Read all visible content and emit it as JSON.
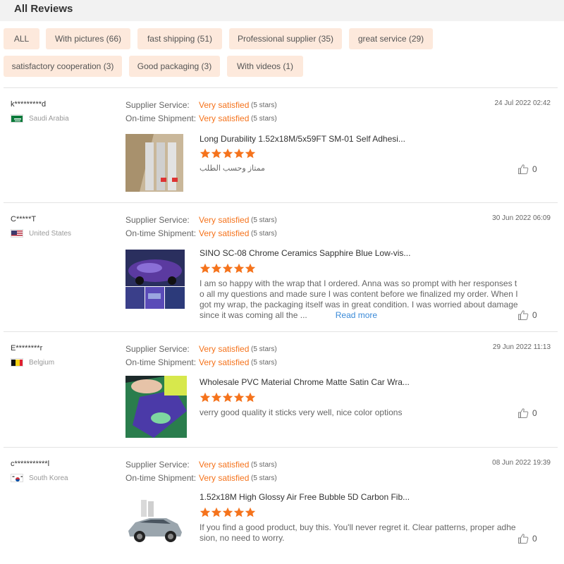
{
  "header": {
    "title": "All Reviews"
  },
  "filters": [
    {
      "label": "ALL"
    },
    {
      "label": "With pictures (66)"
    },
    {
      "label": "fast shipping (51)"
    },
    {
      "label": "Professional supplier (35)"
    },
    {
      "label": "great service (29)"
    },
    {
      "label": "satisfactory cooperation (3)"
    },
    {
      "label": "Good packaging (3)"
    },
    {
      "label": "With videos (1)"
    }
  ],
  "colors": {
    "accent": "#f5731c",
    "chip_bg": "#fde9dc",
    "link": "#3a8ad8"
  },
  "reviews": [
    {
      "user": "k*********d",
      "country": "Saudi Arabia",
      "flag": "saudi-arabia",
      "supplier_label": "Supplier Service:",
      "supplier_value": "Very satisfied",
      "supplier_stars": "(5 stars)",
      "shipment_label": "On-time Shipment:",
      "shipment_value": "Very satisfied",
      "shipment_stars": "(5 stars)",
      "date": "24 Jul 2022 02:42",
      "product": "Long Durability 1.52x18M/5x59FT SM-01 Self Adhesi...",
      "rating": 5,
      "text": "ممتاز وحسب الطلب",
      "likes": "0"
    },
    {
      "user": "C*****T",
      "country": "United States",
      "flag": "united-states",
      "supplier_label": "Supplier Service:",
      "supplier_value": "Very satisfied",
      "supplier_stars": "(5 stars)",
      "shipment_label": "On-time Shipment:",
      "shipment_value": "Very satisfied",
      "shipment_stars": "(5 stars)",
      "date": "30 Jun 2022 06:09",
      "product": "SINO SC-08 Chrome Ceramics Sapphire Blue Low-vis...",
      "rating": 5,
      "text": "I am so happy with the wrap that I ordered. Anna was so prompt with her responses to all my questions and made sure I was content before we finalized my order. When I got my wrap, the packaging itself was in great condition. I was worried about damage since it was coming all the ...",
      "read_more": "Read more",
      "likes": "0"
    },
    {
      "user": "E********r",
      "country": "Belgium",
      "flag": "belgium",
      "supplier_label": "Supplier Service:",
      "supplier_value": "Very satisfied",
      "supplier_stars": "(5 stars)",
      "shipment_label": "On-time Shipment:",
      "shipment_value": "Very satisfied",
      "shipment_stars": "(5 stars)",
      "date": "29 Jun 2022 11:13",
      "product": "Wholesale PVC Material Chrome Matte Satin Car Wra...",
      "rating": 5,
      "text": "verry good quality it sticks very well, nice color options",
      "likes": "0"
    },
    {
      "user": "c***********l",
      "country": "South Korea",
      "flag": "south-korea",
      "supplier_label": "Supplier Service:",
      "supplier_value": "Very satisfied",
      "supplier_stars": "(5 stars)",
      "shipment_label": "On-time Shipment:",
      "shipment_value": "Very satisfied",
      "shipment_stars": "(5 stars)",
      "date": "08 Jun 2022 19:39",
      "product": "1.52x18M High Glossy Air Free Bubble 5D Carbon Fib...",
      "rating": 5,
      "text": "If you find a good product, buy this. You'll never regret it. Clear patterns, proper adhesion, no need to worry.",
      "likes": "0"
    }
  ]
}
